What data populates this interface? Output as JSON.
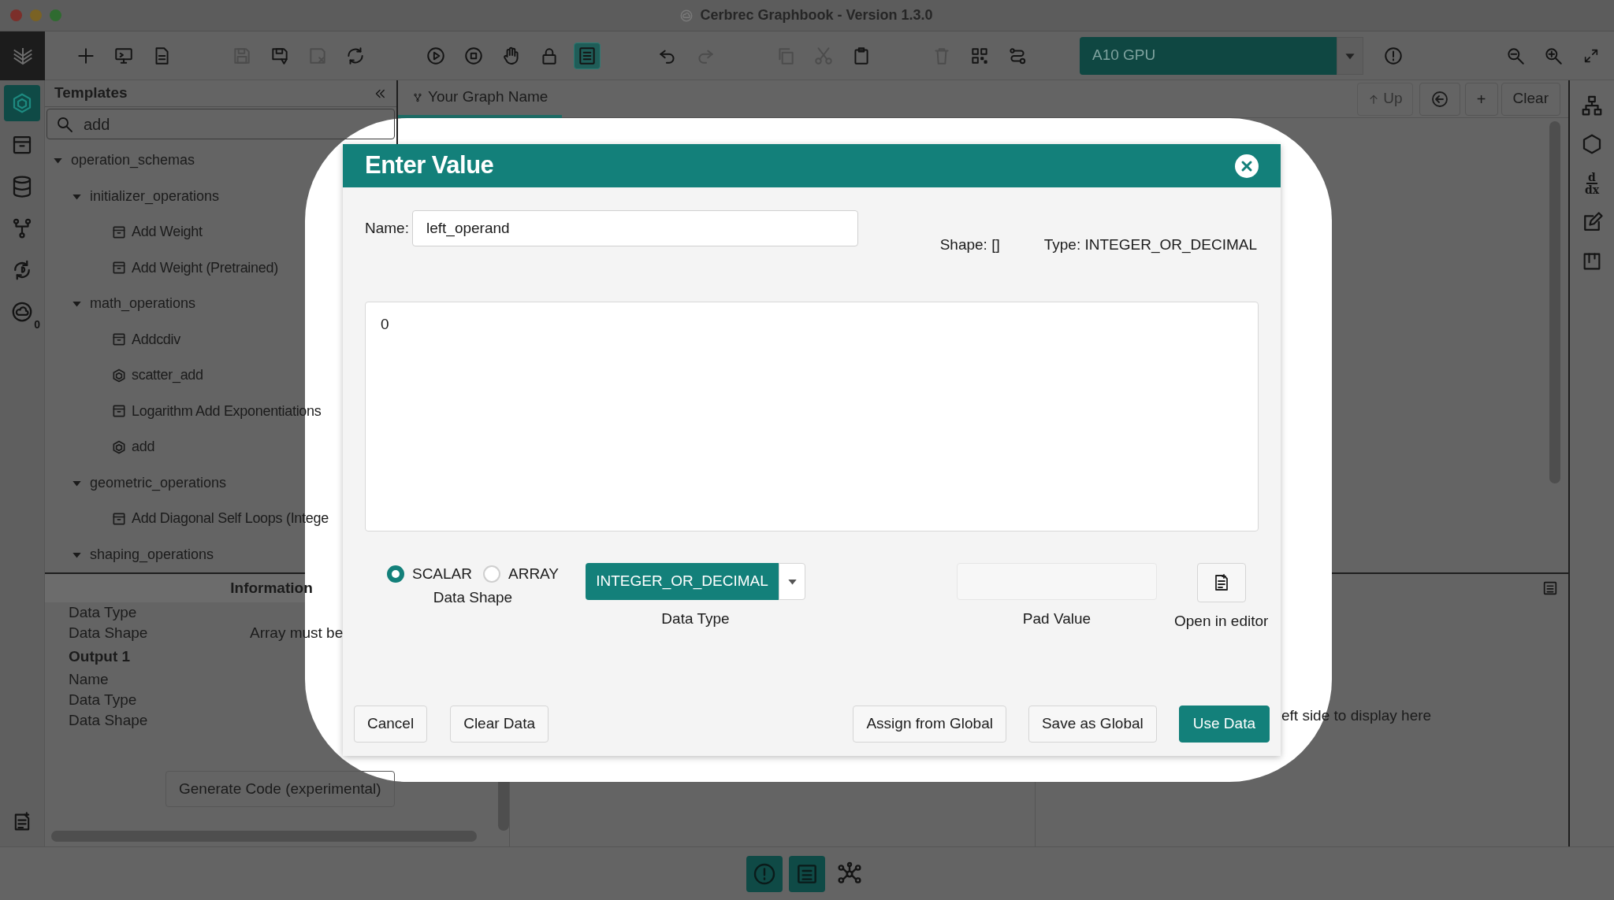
{
  "window": {
    "title": "Cerbrec Graphbook - Version 1.3.0"
  },
  "toolbar": {
    "groups": [
      [
        {
          "disabled": false,
          "selected": false
        },
        {
          "disabled": false,
          "selected": false
        },
        {
          "disabled": false,
          "selected": false
        }
      ],
      [
        {
          "disabled": true,
          "selected": false
        },
        {
          "disabled": false,
          "selected": false
        },
        {
          "disabled": true,
          "selected": false
        },
        {
          "disabled": false,
          "selected": false
        }
      ],
      [
        {
          "disabled": false,
          "selected": false
        },
        {
          "disabled": false,
          "selected": false
        },
        {
          "disabled": false,
          "selected": false
        },
        {
          "disabled": false,
          "selected": false
        },
        {
          "disabled": false,
          "selected": true
        }
      ],
      [
        {
          "disabled": false,
          "selected": false
        },
        {
          "disabled": true,
          "selected": false
        }
      ],
      [
        {
          "disabled": true,
          "selected": false
        },
        {
          "disabled": true,
          "selected": false
        },
        {
          "disabled": false,
          "selected": false
        }
      ],
      [
        {
          "disabled": true,
          "selected": false
        },
        {
          "disabled": false,
          "selected": false
        },
        {
          "disabled": false,
          "selected": false
        }
      ]
    ],
    "device": "A10 GPU"
  },
  "left_rail": [
    {
      "selected": true
    },
    {
      "selected": false
    },
    {
      "selected": false
    },
    {
      "selected": false
    },
    {
      "selected": false
    },
    {
      "selected": false,
      "badge": "0"
    }
  ],
  "templates": {
    "title": "Templates",
    "search": "add",
    "tree": [
      {
        "label": "operation_schemas",
        "expanded": true,
        "children": [
          {
            "label": "initializer_operations",
            "expanded": true,
            "children": [
              {
                "label": "Add Weight",
                "kind": "template"
              },
              {
                "label": "Add Weight (Pretrained)",
                "kind": "template"
              }
            ]
          },
          {
            "label": "math_operations",
            "expanded": true,
            "children": [
              {
                "label": "Addcdiv",
                "kind": "template"
              },
              {
                "label": "scatter_add",
                "kind": "operation"
              },
              {
                "label": "Logarithm Add Exponentiations",
                "kind": "template"
              },
              {
                "label": "add",
                "kind": "operation"
              }
            ]
          },
          {
            "label": "geometric_operations",
            "expanded": true,
            "children": [
              {
                "label": "Add Diagonal Self Loops (Intege",
                "kind": "template"
              }
            ]
          },
          {
            "label": "shaping_operations",
            "expanded": true
          }
        ]
      }
    ]
  },
  "information": {
    "title": "Information",
    "rows": [
      {
        "kind": "field",
        "label": "Data Type"
      },
      {
        "kind": "field",
        "label": "Data Shape",
        "value": "Array must be"
      },
      {
        "kind": "heading",
        "label": "Output 1"
      },
      {
        "kind": "field",
        "label": "Name"
      },
      {
        "kind": "field",
        "label": "Data Type"
      },
      {
        "kind": "field",
        "label": "Data Shape"
      }
    ],
    "button": "Generate Code (experimental)"
  },
  "canvas": {
    "tab": "Your Graph Name",
    "up": "Up",
    "up_disabled": true,
    "add": "+",
    "clear": "Clear"
  },
  "details_text": "eft side to display here",
  "right_rail": {
    "derivative_top": "d",
    "derivative_bottom": "dx"
  },
  "footer": [
    {
      "selected": true
    },
    {
      "selected": true
    },
    {
      "selected": false
    }
  ],
  "dialog": {
    "title": "Enter Value",
    "name_label": "Name:",
    "name_value": "left_operand",
    "shape": "Shape: []",
    "type": "Type: INTEGER_OR_DECIMAL",
    "value": "0",
    "shape_options": [
      {
        "label": "SCALAR",
        "selected": true
      },
      {
        "label": "ARRAY",
        "selected": false
      }
    ],
    "shape_label": "Data Shape",
    "data_type": "INTEGER_OR_DECIMAL",
    "data_type_label": "Data Type",
    "pad_label": "Pad Value",
    "editor_label": "Open in editor",
    "buttons": [
      {
        "label": "Cancel",
        "kind": "plain"
      },
      {
        "label": "Clear Data",
        "kind": "plain"
      },
      {
        "label": "Assign from Global",
        "kind": "plain"
      },
      {
        "label": "Save as Global",
        "kind": "plain"
      },
      {
        "label": "Use Data",
        "kind": "primary"
      }
    ]
  }
}
